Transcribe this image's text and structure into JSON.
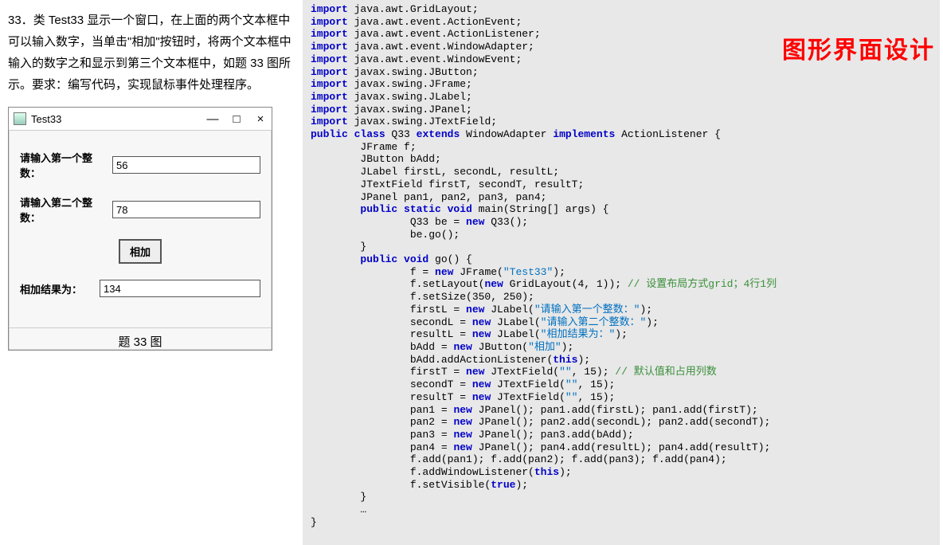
{
  "problem": {
    "number": "33．",
    "text": "类 Test33 显示一个窗口，在上面的两个文本框中可以输入数字，当单击\"相加\"按钮时，将两个文本框中输入的数字之和显示到第三个文本框中，如题 33 图所示。要求：编写代码，实现鼠标事件处理程序。"
  },
  "window": {
    "title": "Test33",
    "min": "—",
    "max": "□",
    "close": "×",
    "label1": "请输入第一个整数：",
    "value1": "56",
    "label2": "请输入第二个整数：",
    "value2": "78",
    "button": "相加",
    "label3": "相加结果为：",
    "value3": "134",
    "caption": "题 33 图"
  },
  "overlay": "图形界面设计",
  "code": {
    "l1a": "import",
    "l1b": " java.awt.GridLayout;",
    "l2a": "import",
    "l2b": " java.awt.event.ActionEvent;",
    "l3a": "import",
    "l3b": " java.awt.event.ActionListener;",
    "l4a": "import",
    "l4b": " java.awt.event.WindowAdapter;",
    "l5a": "import",
    "l5b": " java.awt.event.WindowEvent;",
    "l6a": "import",
    "l6b": " javax.swing.JButton;",
    "l7a": "import",
    "l7b": " javax.swing.JFrame;",
    "l8a": "import",
    "l8b": " javax.swing.JLabel;",
    "l9a": "import",
    "l9b": " javax.swing.JPanel;",
    "l10a": "import",
    "l10b": " javax.swing.JTextField;",
    "l11a": "public class",
    "l11b": " Q33 ",
    "l11c": "extends",
    "l11d": " WindowAdapter ",
    "l11e": "implements",
    "l11f": " ActionListener {",
    "l12": "        JFrame f;",
    "l13": "        JButton bAdd;",
    "l14": "        JLabel firstL, secondL, resultL;",
    "l15": "        JTextField firstT, secondT, resultT;",
    "l16": "        JPanel pan1, pan2, pan3, pan4;",
    "l17a": "        public static void",
    "l17b": " main(String[] args) {",
    "l18a": "                Q33 be = ",
    "l18b": "new",
    "l18c": " Q33();",
    "l19": "                be.go();",
    "l20": "        }",
    "l21a": "        public void",
    "l21b": " go() {",
    "l22a": "                f = ",
    "l22b": "new",
    "l22c": " JFrame(",
    "l22d": "\"Test33\"",
    "l22e": ");",
    "l23a": "                f.setLayout(",
    "l23b": "new",
    "l23c": " GridLayout(4, 1)); ",
    "l23d": "// 设置布局方式grid；4行1列",
    "l24": "                f.setSize(350, 250);",
    "l25a": "                firstL = ",
    "l25b": "new",
    "l25c": " JLabel(",
    "l25d": "\"请输入第一个整数：\"",
    "l25e": ");",
    "l26a": "                secondL = ",
    "l26b": "new",
    "l26c": " JLabel(",
    "l26d": "\"请输入第二个整数：\"",
    "l26e": ");",
    "l27a": "                resultL = ",
    "l27b": "new",
    "l27c": " JLabel(",
    "l27d": "\"相加结果为：\"",
    "l27e": ");",
    "l28a": "                bAdd = ",
    "l28b": "new",
    "l28c": " JButton(",
    "l28d": "\"相加\"",
    "l28e": ");",
    "l29a": "                bAdd.addActionListener(",
    "l29b": "this",
    "l29c": ");",
    "l30a": "                firstT = ",
    "l30b": "new",
    "l30c": " JTextField(",
    "l30d": "\"\"",
    "l30e": ", 15); ",
    "l30f": "// 默认值和占用列数",
    "l31a": "                secondT = ",
    "l31b": "new",
    "l31c": " JTextField(",
    "l31d": "\"\"",
    "l31e": ", 15);",
    "l32a": "                resultT = ",
    "l32b": "new",
    "l32c": " JTextField(",
    "l32d": "\"\"",
    "l32e": ", 15);",
    "l33a": "                pan1 = ",
    "l33b": "new",
    "l33c": " JPanel(); pan1.add(firstL); pan1.add(firstT);",
    "l34a": "                pan2 = ",
    "l34b": "new",
    "l34c": " JPanel(); pan2.add(secondL); pan2.add(secondT);",
    "l35a": "                pan3 = ",
    "l35b": "new",
    "l35c": " JPanel(); pan3.add(bAdd);",
    "l36a": "                pan4 = ",
    "l36b": "new",
    "l36c": " JPanel(); pan4.add(resultL); pan4.add(resultT);",
    "l37": "                f.add(pan1); f.add(pan2); f.add(pan3); f.add(pan4);",
    "l38a": "                f.addWindowListener(",
    "l38b": "this",
    "l38c": ");",
    "l39a": "                f.setVisible(",
    "l39b": "true",
    "l39c": ");",
    "l40": "        }",
    "l41": "        …",
    "l42": "}"
  }
}
